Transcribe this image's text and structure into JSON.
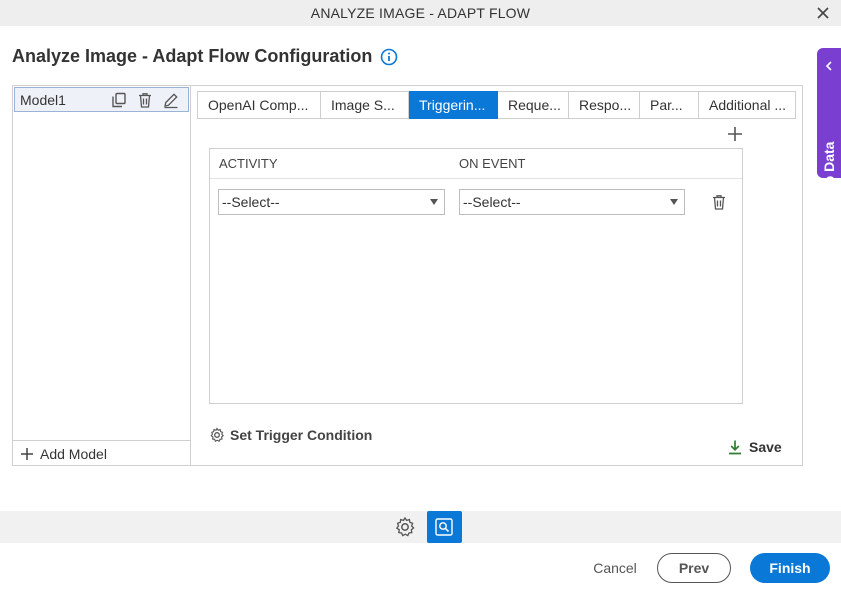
{
  "window": {
    "title": "ANALYZE IMAGE - ADAPT FLOW"
  },
  "page": {
    "title": "Analyze Image - Adapt Flow Configuration"
  },
  "app_data_panel": {
    "label": "App Data"
  },
  "models": {
    "items": [
      {
        "label": "Model1"
      }
    ],
    "add_label": "Add Model"
  },
  "tabs": [
    {
      "label": "OpenAI Comp...",
      "active": false
    },
    {
      "label": "Image S...",
      "active": false
    },
    {
      "label": "Triggerin...",
      "active": true
    },
    {
      "label": "Reque...",
      "active": false
    },
    {
      "label": "Respo...",
      "active": false
    },
    {
      "label": "Par...",
      "active": false
    },
    {
      "label": "Additional ...",
      "active": false
    }
  ],
  "grid": {
    "columns": [
      "ACTIVITY",
      "ON EVENT"
    ],
    "rows": [
      {
        "activity": "--Select--",
        "on_event": "--Select--"
      }
    ]
  },
  "actions": {
    "set_trigger_condition": "Set Trigger Condition",
    "save": "Save"
  },
  "footer": {
    "cancel": "Cancel",
    "prev": "Prev",
    "finish": "Finish"
  },
  "colors": {
    "accent": "#0a78d7",
    "app_data": "#7a3fd0",
    "save_icon": "#2e7d32"
  }
}
